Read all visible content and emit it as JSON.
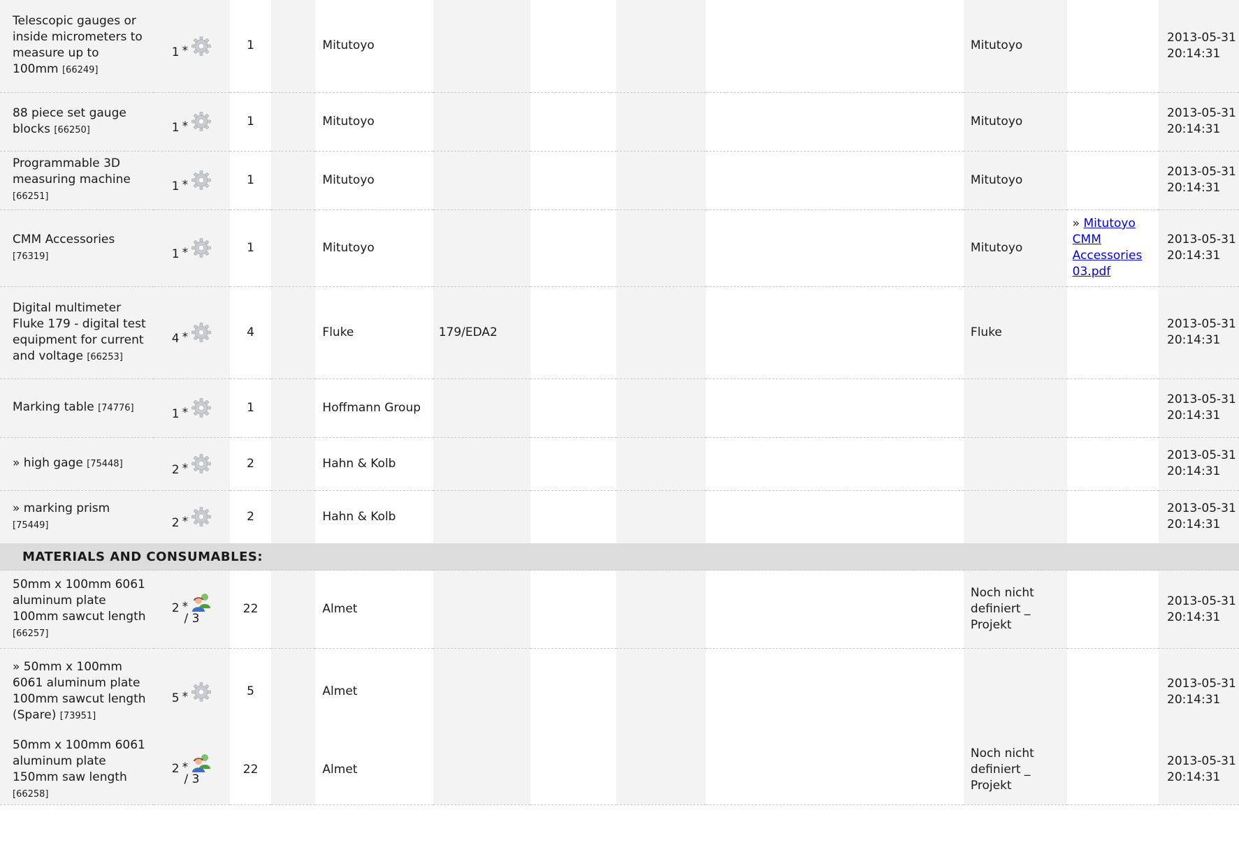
{
  "section_materials": "MATERIALS AND CONSUMABLES:",
  "qty_sep": "*",
  "doc_prefix": "»",
  "colors": {
    "shade": "#f3f3f3",
    "section": "#dcdcdc",
    "link": "#0000ee"
  },
  "rows": [
    {
      "name": "Telescopic gauges or inside micrometers to measure up to 100mm",
      "id": "[66249]",
      "qty": "1",
      "icon": "gear-icon",
      "sub": "",
      "total": "1",
      "maker": "Mitutoyo",
      "model": "",
      "supplier": "Mitutoyo",
      "doc": "",
      "date": "2013-05-31 20:14:31"
    },
    {
      "name": "88 piece set gauge blocks",
      "id": "[66250]",
      "qty": "1",
      "icon": "gear-icon",
      "sub": "",
      "total": "1",
      "maker": "Mitutoyo",
      "model": "",
      "supplier": "Mitutoyo",
      "doc": "",
      "date": "2013-05-31 20:14:31"
    },
    {
      "name": "Programmable 3D measuring machine",
      "id": "[66251]",
      "qty": "1",
      "icon": "gear-icon",
      "sub": "",
      "total": "1",
      "maker": "Mitutoyo",
      "model": "",
      "supplier": "Mitutoyo",
      "doc": "",
      "date": "2013-05-31 20:14:31"
    },
    {
      "name": "CMM Accessories",
      "id": "[76319]",
      "qty": "1",
      "icon": "gear-icon",
      "sub": "",
      "total": "1",
      "maker": "Mitutoyo",
      "model": "",
      "supplier": "Mitutoyo",
      "doc": "Mitutoyo CMM Accessories 03.pdf",
      "date": "2013-05-31 20:14:31"
    },
    {
      "name": "Digital multimeter Fluke 179 - digital test equipment for current and voltage",
      "id": "[66253]",
      "qty": "4",
      "icon": "gear-icon",
      "sub": "",
      "total": "4",
      "maker": "Fluke",
      "model": "179/EDA2",
      "supplier": "Fluke",
      "doc": "",
      "date": "2013-05-31 20:14:31"
    },
    {
      "name": "Marking table",
      "id": "[74776]",
      "qty": "1",
      "icon": "gear-icon",
      "sub": "",
      "total": "1",
      "maker": "Hoffmann Group",
      "model": "",
      "supplier": "",
      "doc": "",
      "date": "2013-05-31 20:14:31"
    },
    {
      "name": "» high gage",
      "id": "[75448]",
      "qty": "2",
      "icon": "gear-icon",
      "sub": "",
      "total": "2",
      "maker": "Hahn & Kolb",
      "model": "",
      "supplier": "",
      "doc": "",
      "date": "2013-05-31 20:14:31"
    },
    {
      "name": "» marking prism",
      "id": "[75449]",
      "qty": "2",
      "icon": "gear-icon",
      "sub": "",
      "total": "2",
      "maker": "Hahn & Kolb",
      "model": "",
      "supplier": "",
      "doc": "",
      "date": "2013-05-31 20:14:31"
    },
    {
      "name": "50mm x 100mm 6061 aluminum plate 100mm sawcut length",
      "id": "[66257]",
      "qty": "2",
      "icon": "people-icon",
      "sub": "/ 3",
      "total": "22",
      "maker": "Almet",
      "model": "",
      "supplier": "Noch nicht definiert _ Projekt",
      "doc": "",
      "date": "2013-05-31 20:14:31"
    },
    {
      "name": "» 50mm x 100mm 6061 aluminum plate 100mm sawcut length (Spare)",
      "id": "[73951]",
      "qty": "5",
      "icon": "gear-icon",
      "sub": "",
      "total": "5",
      "maker": "Almet",
      "model": "",
      "supplier": "",
      "doc": "",
      "date": "2013-05-31 20:14:31"
    },
    {
      "name": "50mm x 100mm 6061 aluminum plate 150mm saw length",
      "id": "[66258]",
      "qty": "2",
      "icon": "people-icon",
      "sub": "/ 3",
      "total": "22",
      "maker": "Almet",
      "model": "",
      "supplier": "Noch nicht definiert _ Projekt",
      "doc": "",
      "date": "2013-05-31 20:14:31"
    }
  ]
}
